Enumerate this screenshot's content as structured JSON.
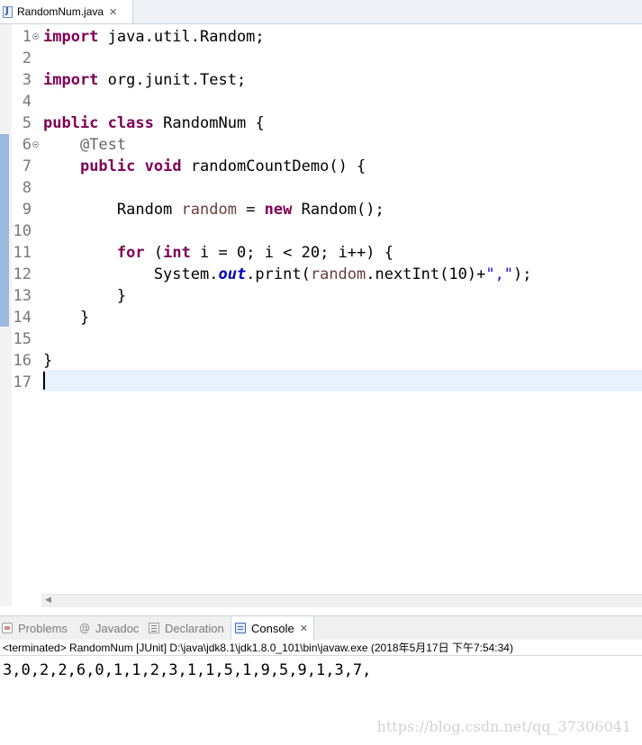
{
  "editor": {
    "tab": {
      "title": "RandomNum.java",
      "close_glyph": "✕",
      "icon": "java-file-icon"
    },
    "lines": [
      {
        "n": "1",
        "segs": [
          {
            "t": "import",
            "c": "kw"
          },
          {
            "t": " java.util.Random;",
            "c": ""
          }
        ]
      },
      {
        "n": "2",
        "segs": []
      },
      {
        "n": "3",
        "segs": [
          {
            "t": "import",
            "c": "kw"
          },
          {
            "t": " org.junit.Test;",
            "c": ""
          }
        ]
      },
      {
        "n": "4",
        "segs": []
      },
      {
        "n": "5",
        "segs": [
          {
            "t": "public",
            "c": "kw"
          },
          {
            "t": " ",
            "c": ""
          },
          {
            "t": "class",
            "c": "kw"
          },
          {
            "t": " RandomNum {",
            "c": ""
          }
        ]
      },
      {
        "n": "6",
        "segs": [
          {
            "t": "    ",
            "c": ""
          },
          {
            "t": "@Test",
            "c": "ann"
          }
        ]
      },
      {
        "n": "7",
        "segs": [
          {
            "t": "    ",
            "c": ""
          },
          {
            "t": "public",
            "c": "kw"
          },
          {
            "t": " ",
            "c": ""
          },
          {
            "t": "void",
            "c": "kw"
          },
          {
            "t": " randomCountDemo() {",
            "c": ""
          }
        ]
      },
      {
        "n": "8",
        "segs": []
      },
      {
        "n": "9",
        "segs": [
          {
            "t": "        Random ",
            "c": ""
          },
          {
            "t": "random",
            "c": "lv"
          },
          {
            "t": " = ",
            "c": ""
          },
          {
            "t": "new",
            "c": "kw"
          },
          {
            "t": " Random();",
            "c": ""
          }
        ]
      },
      {
        "n": "10",
        "segs": []
      },
      {
        "n": "11",
        "segs": [
          {
            "t": "        ",
            "c": ""
          },
          {
            "t": "for",
            "c": "kw"
          },
          {
            "t": " (",
            "c": ""
          },
          {
            "t": "int",
            "c": "kw"
          },
          {
            "t": " i = 0; i < 20; i++) {",
            "c": ""
          }
        ]
      },
      {
        "n": "12",
        "segs": [
          {
            "t": "            System.",
            "c": ""
          },
          {
            "t": "out",
            "c": "st"
          },
          {
            "t": ".print(",
            "c": ""
          },
          {
            "t": "random",
            "c": "lv"
          },
          {
            "t": ".nextInt(10)+",
            "c": ""
          },
          {
            "t": "\",\"",
            "c": "str"
          },
          {
            "t": ");",
            "c": ""
          }
        ]
      },
      {
        "n": "13",
        "segs": [
          {
            "t": "        }",
            "c": ""
          }
        ]
      },
      {
        "n": "14",
        "segs": [
          {
            "t": "    }",
            "c": ""
          }
        ]
      },
      {
        "n": "15",
        "segs": []
      },
      {
        "n": "16",
        "segs": [
          {
            "t": "}",
            "c": ""
          }
        ]
      },
      {
        "n": "17",
        "segs": []
      }
    ]
  },
  "views": {
    "tabs": [
      {
        "label": "Problems",
        "icon": "problems-icon"
      },
      {
        "label": "Javadoc",
        "icon": "javadoc-icon",
        "glyph": "@"
      },
      {
        "label": "Declaration",
        "icon": "declaration-icon"
      },
      {
        "label": "Console",
        "icon": "console-icon",
        "active": true,
        "close_glyph": "✕"
      }
    ]
  },
  "console": {
    "status": "<terminated> RandomNum [JUnit] D:\\java\\jdk8.1\\jdk1.8.0_101\\bin\\javaw.exe (2018年5月17日 下午7:54:34)",
    "output": "3,0,2,2,6,0,1,1,2,3,1,1,5,1,9,5,9,1,3,7,"
  },
  "watermark": "https://blog.csdn.net/qq_37306041",
  "colors": {
    "keyword": "#7f0055",
    "annotation": "#646464",
    "local_variable": "#6a3e3e",
    "static_field": "#0000c0",
    "string": "#2a00ff",
    "current_line": "#e8f2fe",
    "change_bar": "#9bb8de"
  }
}
